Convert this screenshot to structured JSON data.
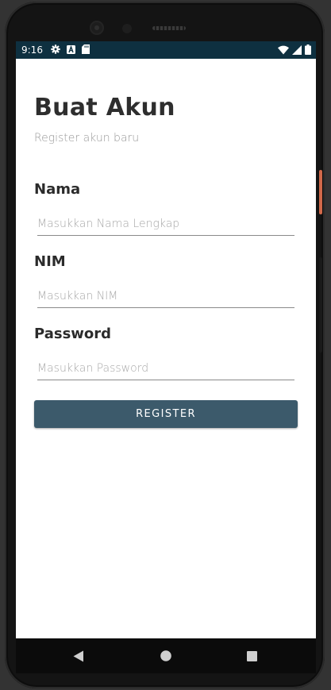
{
  "status_bar": {
    "time": "9:16",
    "left_icons": [
      "gear-icon",
      "a-badge-icon",
      "sd-card-icon"
    ],
    "right_icons": [
      "wifi-icon",
      "signal-icon",
      "battery-icon"
    ]
  },
  "page": {
    "title": "Buat Akun",
    "subtitle": "Register akun baru"
  },
  "form": {
    "fields": [
      {
        "label": "Nama",
        "value": "",
        "placeholder": "Masukkan Nama Lengkap"
      },
      {
        "label": "NIM",
        "value": "",
        "placeholder": "Masukkan NIM"
      },
      {
        "label": "Password",
        "value": "",
        "placeholder": "Masukkan Password"
      }
    ],
    "submit_label": "REGISTER"
  },
  "nav_bar": {
    "icons": [
      "back-icon",
      "home-icon",
      "recents-icon"
    ]
  },
  "colors": {
    "status_bar": "#0e3040",
    "button": "#3c5a6b",
    "title_text": "#2e2e2e",
    "hint_text": "#a8a8a8",
    "power_button_accent": "#d2694a"
  }
}
